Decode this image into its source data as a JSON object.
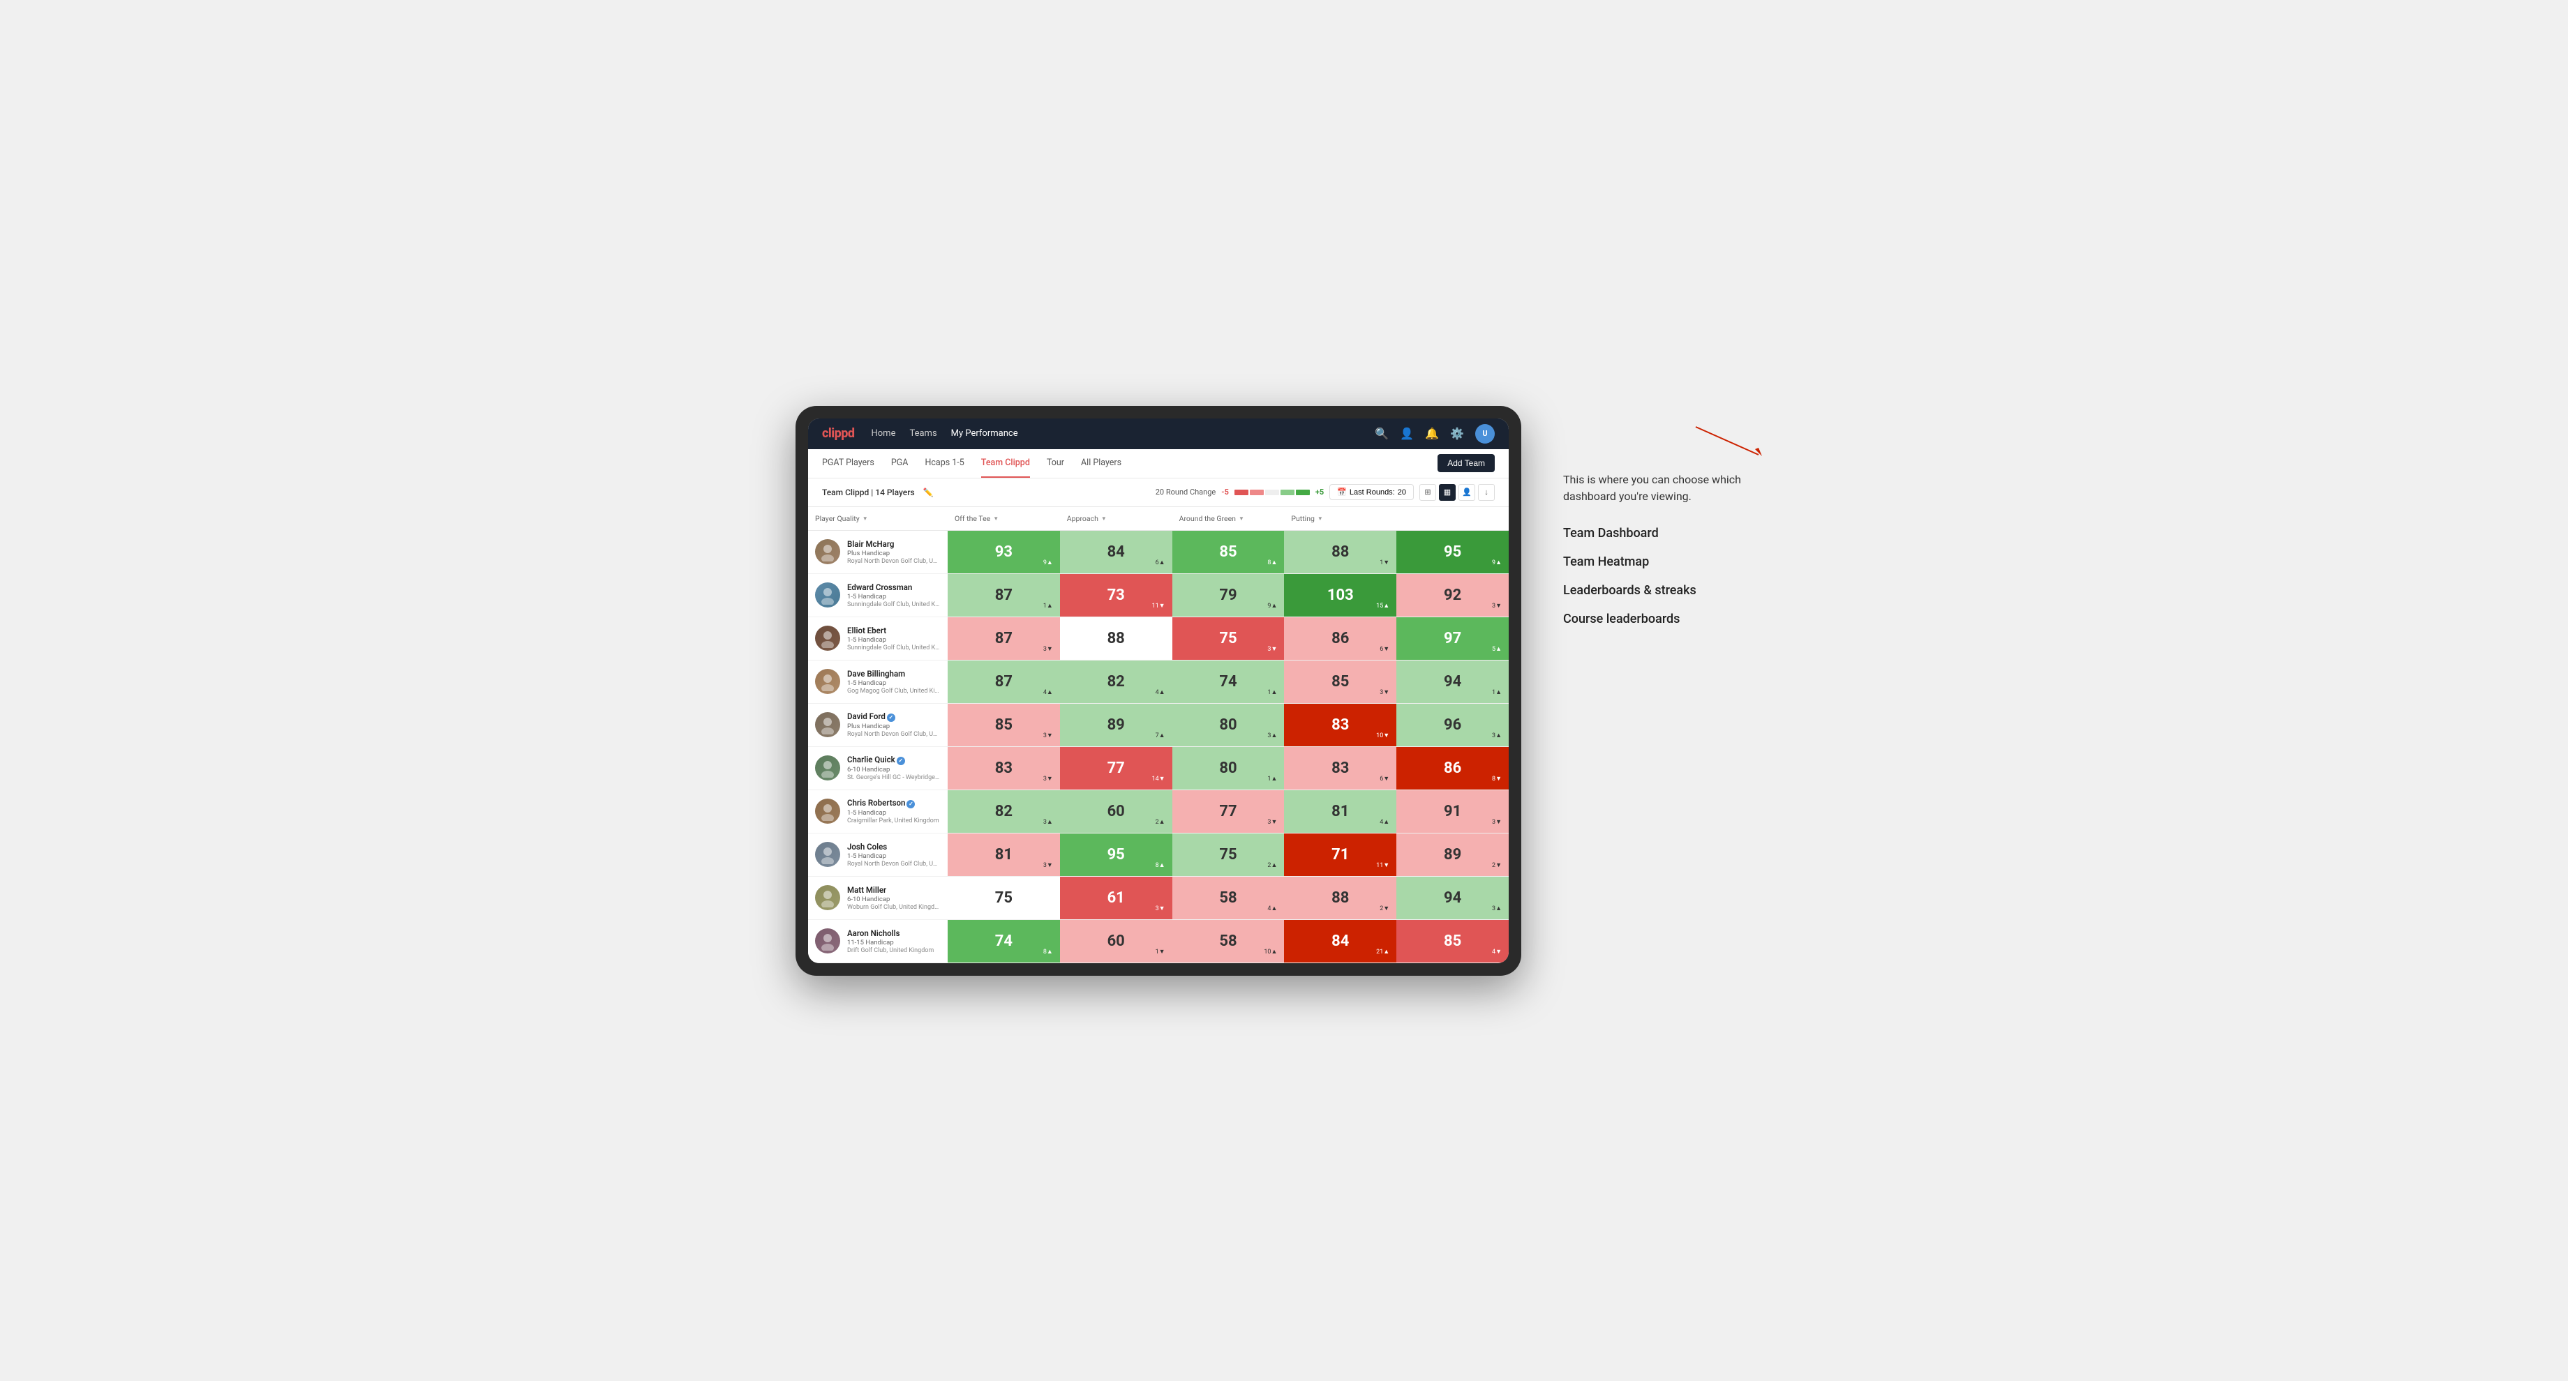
{
  "annotation": {
    "intro_text": "This is where you can choose which dashboard you're viewing.",
    "items": [
      "Team Dashboard",
      "Team Heatmap",
      "Leaderboards & streaks",
      "Course leaderboards"
    ]
  },
  "nav": {
    "logo": "clippd",
    "links": [
      {
        "label": "Home",
        "active": false
      },
      {
        "label": "Teams",
        "active": false
      },
      {
        "label": "My Performance",
        "active": true
      }
    ]
  },
  "sub_nav": {
    "tabs": [
      {
        "label": "PGAT Players",
        "active": false
      },
      {
        "label": "PGA",
        "active": false
      },
      {
        "label": "Hcaps 1-5",
        "active": false
      },
      {
        "label": "Team Clippd",
        "active": true
      },
      {
        "label": "Tour",
        "active": false
      },
      {
        "label": "All Players",
        "active": false
      }
    ],
    "add_team_label": "Add Team"
  },
  "team_header": {
    "team_name": "Team Clippd",
    "player_count": "14 Players",
    "round_change_label": "20 Round Change",
    "range_min": "-5",
    "range_max": "+5",
    "last_rounds_label": "Last Rounds:",
    "last_rounds_value": "20"
  },
  "table": {
    "columns": [
      {
        "label": "Player Quality",
        "sortable": true
      },
      {
        "label": "Off the Tee",
        "sortable": true
      },
      {
        "label": "Approach",
        "sortable": true
      },
      {
        "label": "Around the Green",
        "sortable": true
      },
      {
        "label": "Putting",
        "sortable": true
      }
    ],
    "rows": [
      {
        "name": "Blair McHarg",
        "handicap": "Plus Handicap",
        "club": "Royal North Devon Golf Club, United Kingdom",
        "avatar_class": "av-1",
        "scores": [
          {
            "value": "93",
            "change": "9",
            "dir": "up",
            "color": "green-mid"
          },
          {
            "value": "84",
            "change": "6",
            "dir": "up",
            "color": "green-light"
          },
          {
            "value": "85",
            "change": "8",
            "dir": "up",
            "color": "green-mid"
          },
          {
            "value": "88",
            "change": "1",
            "dir": "down",
            "color": "green-light"
          },
          {
            "value": "95",
            "change": "9",
            "dir": "up",
            "color": "green-dark"
          }
        ]
      },
      {
        "name": "Edward Crossman",
        "handicap": "1-5 Handicap",
        "club": "Sunningdale Golf Club, United Kingdom",
        "avatar_class": "av-2",
        "scores": [
          {
            "value": "87",
            "change": "1",
            "dir": "up",
            "color": "green-light"
          },
          {
            "value": "73",
            "change": "11",
            "dir": "down",
            "color": "red-mid"
          },
          {
            "value": "79",
            "change": "9",
            "dir": "up",
            "color": "green-light"
          },
          {
            "value": "103",
            "change": "15",
            "dir": "up",
            "color": "green-dark"
          },
          {
            "value": "92",
            "change": "3",
            "dir": "down",
            "color": "red-light"
          }
        ]
      },
      {
        "name": "Elliot Ebert",
        "handicap": "1-5 Handicap",
        "club": "Sunningdale Golf Club, United Kingdom",
        "avatar_class": "av-3",
        "scores": [
          {
            "value": "87",
            "change": "3",
            "dir": "down",
            "color": "red-light"
          },
          {
            "value": "88",
            "change": "",
            "dir": "",
            "color": "white"
          },
          {
            "value": "75",
            "change": "3",
            "dir": "down",
            "color": "red-mid"
          },
          {
            "value": "86",
            "change": "6",
            "dir": "down",
            "color": "red-light"
          },
          {
            "value": "97",
            "change": "5",
            "dir": "up",
            "color": "green-mid"
          }
        ]
      },
      {
        "name": "Dave Billingham",
        "handicap": "1-5 Handicap",
        "club": "Gog Magog Golf Club, United Kingdom",
        "avatar_class": "av-4",
        "scores": [
          {
            "value": "87",
            "change": "4",
            "dir": "up",
            "color": "green-light"
          },
          {
            "value": "82",
            "change": "4",
            "dir": "up",
            "color": "green-light"
          },
          {
            "value": "74",
            "change": "1",
            "dir": "up",
            "color": "green-light"
          },
          {
            "value": "85",
            "change": "3",
            "dir": "down",
            "color": "red-light"
          },
          {
            "value": "94",
            "change": "1",
            "dir": "up",
            "color": "green-light"
          }
        ]
      },
      {
        "name": "David Ford",
        "handicap": "Plus Handicap",
        "club": "Royal North Devon Golf Club, United Kingdom",
        "avatar_class": "av-5",
        "verified": true,
        "scores": [
          {
            "value": "85",
            "change": "3",
            "dir": "down",
            "color": "red-light"
          },
          {
            "value": "89",
            "change": "7",
            "dir": "up",
            "color": "green-light"
          },
          {
            "value": "80",
            "change": "3",
            "dir": "up",
            "color": "green-light"
          },
          {
            "value": "83",
            "change": "10",
            "dir": "down",
            "color": "red-dark"
          },
          {
            "value": "96",
            "change": "3",
            "dir": "up",
            "color": "green-light"
          }
        ]
      },
      {
        "name": "Charlie Quick",
        "handicap": "6-10 Handicap",
        "club": "St. George's Hill GC - Weybridge - Surrey, Uni...",
        "avatar_class": "av-6",
        "verified": true,
        "scores": [
          {
            "value": "83",
            "change": "3",
            "dir": "down",
            "color": "red-light"
          },
          {
            "value": "77",
            "change": "14",
            "dir": "down",
            "color": "red-mid"
          },
          {
            "value": "80",
            "change": "1",
            "dir": "up",
            "color": "green-light"
          },
          {
            "value": "83",
            "change": "6",
            "dir": "down",
            "color": "red-light"
          },
          {
            "value": "86",
            "change": "8",
            "dir": "down",
            "color": "red-dark"
          }
        ]
      },
      {
        "name": "Chris Robertson",
        "handicap": "1-5 Handicap",
        "club": "Craigmillar Park, United Kingdom",
        "avatar_class": "av-7",
        "verified": true,
        "scores": [
          {
            "value": "82",
            "change": "3",
            "dir": "up",
            "color": "green-light"
          },
          {
            "value": "60",
            "change": "2",
            "dir": "up",
            "color": "green-light"
          },
          {
            "value": "77",
            "change": "3",
            "dir": "down",
            "color": "red-light"
          },
          {
            "value": "81",
            "change": "4",
            "dir": "up",
            "color": "green-light"
          },
          {
            "value": "91",
            "change": "3",
            "dir": "down",
            "color": "red-light"
          }
        ]
      },
      {
        "name": "Josh Coles",
        "handicap": "1-5 Handicap",
        "club": "Royal North Devon Golf Club, United Kingdom",
        "avatar_class": "av-8",
        "scores": [
          {
            "value": "81",
            "change": "3",
            "dir": "down",
            "color": "red-light"
          },
          {
            "value": "95",
            "change": "8",
            "dir": "up",
            "color": "green-mid"
          },
          {
            "value": "75",
            "change": "2",
            "dir": "up",
            "color": "green-light"
          },
          {
            "value": "71",
            "change": "11",
            "dir": "down",
            "color": "red-dark"
          },
          {
            "value": "89",
            "change": "2",
            "dir": "down",
            "color": "red-light"
          }
        ]
      },
      {
        "name": "Matt Miller",
        "handicap": "6-10 Handicap",
        "club": "Woburn Golf Club, United Kingdom",
        "avatar_class": "av-9",
        "scores": [
          {
            "value": "75",
            "change": "",
            "dir": "",
            "color": "white"
          },
          {
            "value": "61",
            "change": "3",
            "dir": "down",
            "color": "red-mid"
          },
          {
            "value": "58",
            "change": "4",
            "dir": "up",
            "color": "red-light"
          },
          {
            "value": "88",
            "change": "2",
            "dir": "down",
            "color": "red-light"
          },
          {
            "value": "94",
            "change": "3",
            "dir": "up",
            "color": "green-light"
          }
        ]
      },
      {
        "name": "Aaron Nicholls",
        "handicap": "11-15 Handicap",
        "club": "Drift Golf Club, United Kingdom",
        "avatar_class": "av-10",
        "scores": [
          {
            "value": "74",
            "change": "8",
            "dir": "up",
            "color": "green-mid"
          },
          {
            "value": "60",
            "change": "1",
            "dir": "down",
            "color": "red-light"
          },
          {
            "value": "58",
            "change": "10",
            "dir": "up",
            "color": "red-light"
          },
          {
            "value": "84",
            "change": "21",
            "dir": "up",
            "color": "red-dark"
          },
          {
            "value": "85",
            "change": "4",
            "dir": "down",
            "color": "red-mid"
          }
        ]
      }
    ]
  },
  "colors": {
    "green_dark": "#3a9a3a",
    "green_mid": "#5cb85c",
    "green_light": "#a8d8a8",
    "red_dark": "#cc2200",
    "red_mid": "#e05555",
    "red_light": "#f5b0b0",
    "white": "#ffffff",
    "nav_bg": "#1a2332"
  }
}
